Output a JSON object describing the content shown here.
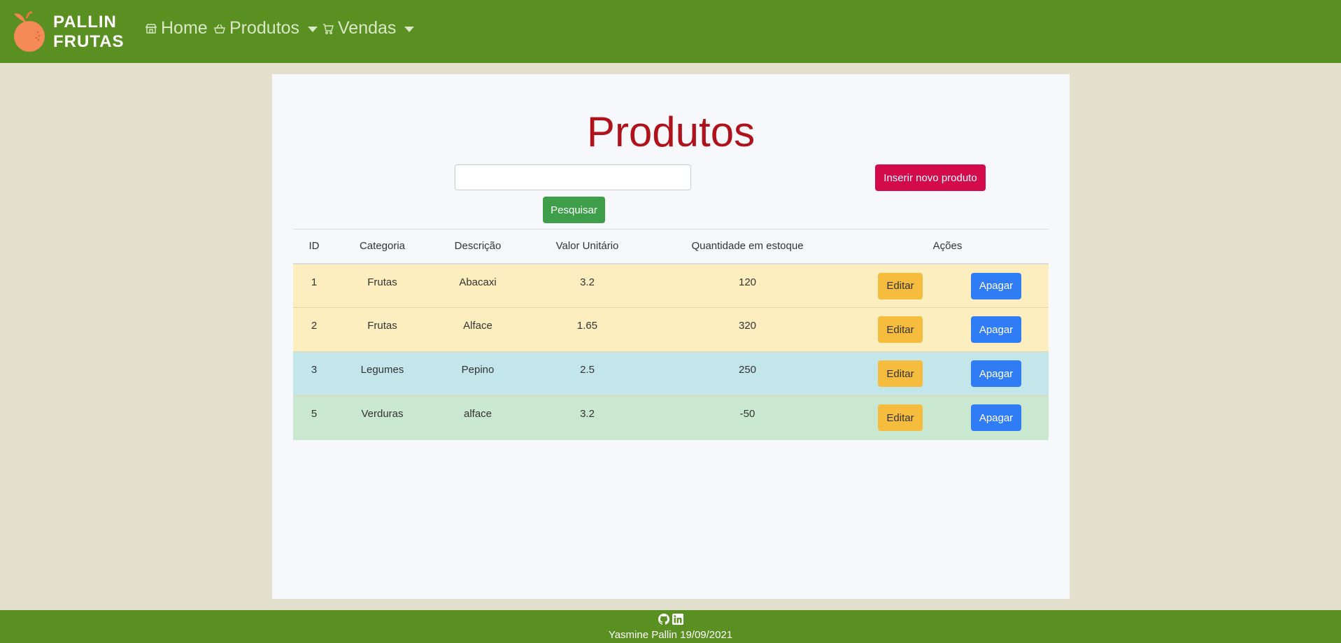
{
  "brand": {
    "line1": "PALLIN",
    "line2": "FRUTAS",
    "logo_icon": "orange-fruit-icon"
  },
  "nav": {
    "items": [
      {
        "label": "Home",
        "icon": "store-icon",
        "dropdown": false
      },
      {
        "label": "Produtos",
        "icon": "basket-icon",
        "dropdown": true
      },
      {
        "label": "Vendas",
        "icon": "cart-icon",
        "dropdown": true
      }
    ]
  },
  "page": {
    "title": "Produtos"
  },
  "search": {
    "value": "",
    "button_label": "Pesquisar"
  },
  "insert_button_label": "Inserir novo produto",
  "table": {
    "headers": [
      "ID",
      "Categoria",
      "Descrição",
      "Valor Unitário",
      "Quantidade em estoque",
      "Ações"
    ],
    "rows": [
      {
        "id": "1",
        "categoria": "Frutas",
        "descricao": "Abacaxi",
        "valor": "3.2",
        "quantidade": "120",
        "row_color": "#fdeebf"
      },
      {
        "id": "2",
        "categoria": "Frutas",
        "descricao": "Alface",
        "valor": "1.65",
        "quantidade": "320",
        "row_color": "#fdeebf"
      },
      {
        "id": "3",
        "categoria": "Legumes",
        "descricao": "Pepino",
        "valor": "2.5",
        "quantidade": "250",
        "row_color": "#c3e6eb"
      },
      {
        "id": "5",
        "categoria": "Verduras",
        "descricao": "alface",
        "valor": "3.2",
        "quantidade": "-50",
        "row_color": "#c9e8cf"
      }
    ],
    "edit_label": "Editar",
    "delete_label": "Apagar"
  },
  "footer": {
    "text": "Yasmine Pallin 19/09/2021",
    "icons": [
      "github-icon",
      "linkedin-icon"
    ]
  },
  "colors": {
    "navbar": "#5a8f22",
    "title": "#b0121b",
    "insert_button": "#d30a4c",
    "search_button": "#3e9e4a",
    "edit_button": "#f6bc3e",
    "delete_button": "#2f7cf5"
  }
}
